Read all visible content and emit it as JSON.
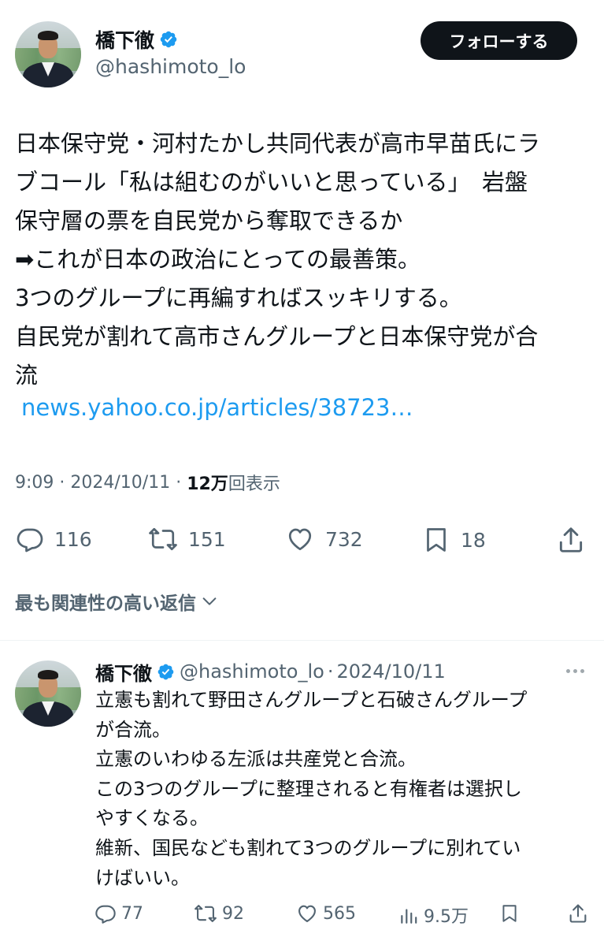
{
  "tweet": {
    "author": {
      "display_name": "橋下徹",
      "handle": "@hashimoto_lo",
      "verified": true
    },
    "follow_label": "フォローする",
    "text_lines": [
      "日本保守党・河村たかし共同代表が高市早苗氏にラ",
      "ブコール「私は組むのがいいと思っている」　岩盤",
      "保守層の票を自民党から奪取できるか",
      "➡︎これが日本の政治にとっての最善策。",
      "3つのグループに再編すればスッキリする。",
      "自民党が割れて高市さんグループと日本保守党が合",
      "流"
    ],
    "link": "news.yahoo.co.jp/articles/38723…",
    "time": "9:09",
    "date": "2024/10/11",
    "views_count": "12万",
    "views_label": "回表示",
    "actions": {
      "replies": "116",
      "reposts": "151",
      "likes": "732",
      "bookmarks": "18"
    }
  },
  "replies_sort_label": "最も関連性の高い返信",
  "reply": {
    "author": {
      "display_name": "橋下徹",
      "handle": "@hashimoto_lo",
      "verified": true
    },
    "date": "2024/10/11",
    "text_lines": [
      "立憲も割れて野田さんグループと石破さんグループ",
      "が合流。",
      "立憲のいわゆる左派は共産党と合流。",
      "この3つのグループに整理されると有権者は選択し",
      "やすくなる。",
      "維新、国民なども割れて3つのグループに別れてい",
      "けばいい。"
    ],
    "actions": {
      "replies": "77",
      "reposts": "92",
      "likes": "565",
      "views": "9.5万"
    }
  },
  "colors": {
    "text": "#0f1419",
    "secondary": "#536471",
    "link": "#1d9bf0",
    "verified": "#1d9bf0",
    "button_bg": "#0f1419"
  },
  "icons": [
    "verified-badge-icon",
    "reply-icon",
    "repost-icon",
    "like-icon",
    "bookmark-icon",
    "share-icon",
    "chevron-down-icon",
    "more-icon",
    "views-icon"
  ]
}
